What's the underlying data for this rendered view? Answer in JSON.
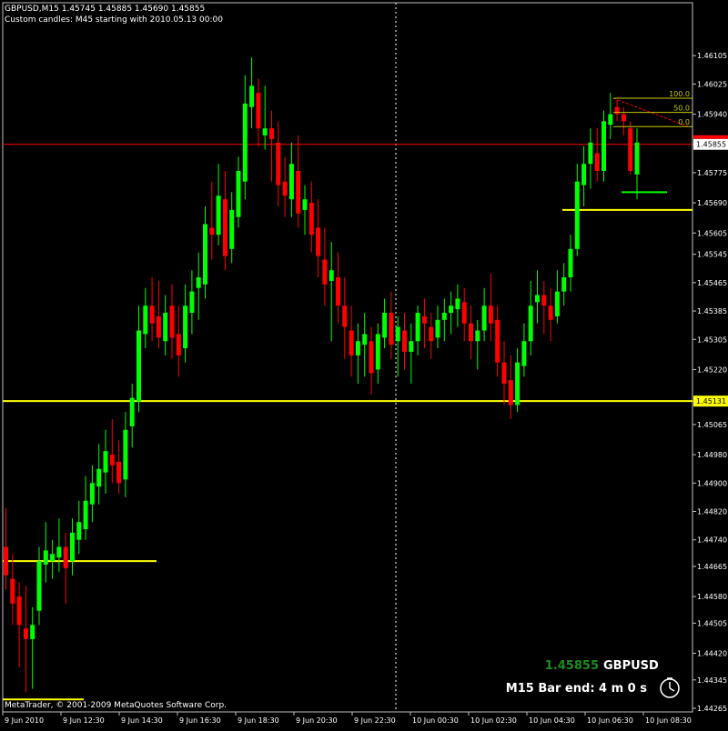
{
  "header": {
    "line1": "GBPUSD,M15  1.45745 1.45885 1.45690 1.45855",
    "line2": "Custom candles: M45 starting with 2010.05.13 00:00"
  },
  "footer": {
    "copyright": "MetaTrader, © 2001-2009 MetaQuotes Software Corp."
  },
  "info_panel": {
    "price": "1.45855",
    "symbol": "GBPUSD",
    "bar_end": "M15 Bar end: 4 m 0 s",
    "icon": "clock-icon"
  },
  "colors": {
    "background": "#000000",
    "bull": "#00ff00",
    "bear": "#ff0000",
    "level": "#ffff00",
    "bid_line": "#ff0000",
    "fib": "#c8c800",
    "price_label_green": "#1e8c1e"
  },
  "price_axis": {
    "ticks": [
      "1.46105",
      "1.46025",
      "1.45940",
      "1.45855",
      "1.45775",
      "1.45690",
      "1.45605",
      "1.45545",
      "1.45465",
      "1.45385",
      "1.45305",
      "1.45220",
      "1.45131",
      "1.45065",
      "1.44980",
      "1.44900",
      "1.44820",
      "1.44740",
      "1.44665",
      "1.44580",
      "1.44505",
      "1.44420",
      "1.44345",
      "1.44265"
    ],
    "current_price_label": "1.45855",
    "level_label": "1.45131"
  },
  "time_axis": {
    "ticks": [
      "9 Jun 2010",
      "9 Jun 12:30",
      "9 Jun 14:30",
      "9 Jun 16:30",
      "9 Jun 18:30",
      "9 Jun 20:30",
      "9 Jun 22:30",
      "10 Jun 00:30",
      "10 Jun 02:30",
      "10 Jun 04:30",
      "10 Jun 06:30",
      "10 Jun 08:30"
    ]
  },
  "fib": {
    "levels": [
      "100.0",
      "50.0",
      "0.0"
    ]
  },
  "chart_data": {
    "type": "candlestick",
    "ylim": [
      1.44265,
      1.46185
    ],
    "grid": false,
    "horizontal_levels": [
      1.45131,
      1.4567
    ],
    "candles": [
      {
        "o": 1.4472,
        "h": 1.4483,
        "l": 1.446,
        "c": 1.4464
      },
      {
        "o": 1.4463,
        "h": 1.447,
        "l": 1.445,
        "c": 1.4456
      },
      {
        "o": 1.4458,
        "h": 1.4462,
        "l": 1.4438,
        "c": 1.445
      },
      {
        "o": 1.4449,
        "h": 1.4461,
        "l": 1.4431,
        "c": 1.4446
      },
      {
        "o": 1.4446,
        "h": 1.4455,
        "l": 1.4432,
        "c": 1.445
      },
      {
        "o": 1.4454,
        "h": 1.4472,
        "l": 1.445,
        "c": 1.4468
      },
      {
        "o": 1.4467,
        "h": 1.4479,
        "l": 1.4462,
        "c": 1.4471
      },
      {
        "o": 1.4468,
        "h": 1.4474,
        "l": 1.4463,
        "c": 1.447
      },
      {
        "o": 1.4469,
        "h": 1.448,
        "l": 1.4465,
        "c": 1.4472
      },
      {
        "o": 1.4472,
        "h": 1.4476,
        "l": 1.4456,
        "c": 1.4466
      },
      {
        "o": 1.4468,
        "h": 1.448,
        "l": 1.4464,
        "c": 1.4476
      },
      {
        "o": 1.4474,
        "h": 1.4485,
        "l": 1.447,
        "c": 1.4479
      },
      {
        "o": 1.4477,
        "h": 1.4492,
        "l": 1.4474,
        "c": 1.4485
      },
      {
        "o": 1.4484,
        "h": 1.4495,
        "l": 1.4479,
        "c": 1.449
      },
      {
        "o": 1.4489,
        "h": 1.4501,
        "l": 1.4484,
        "c": 1.4494
      },
      {
        "o": 1.4493,
        "h": 1.4505,
        "l": 1.4487,
        "c": 1.4499
      },
      {
        "o": 1.4498,
        "h": 1.4508,
        "l": 1.449,
        "c": 1.4495
      },
      {
        "o": 1.4496,
        "h": 1.4502,
        "l": 1.4487,
        "c": 1.449
      },
      {
        "o": 1.4491,
        "h": 1.451,
        "l": 1.4486,
        "c": 1.4505
      },
      {
        "o": 1.4506,
        "h": 1.4518,
        "l": 1.45,
        "c": 1.4514
      },
      {
        "o": 1.4513,
        "h": 1.454,
        "l": 1.451,
        "c": 1.4533
      },
      {
        "o": 1.4532,
        "h": 1.4545,
        "l": 1.4528,
        "c": 1.454
      },
      {
        "o": 1.454,
        "h": 1.4548,
        "l": 1.453,
        "c": 1.4535
      },
      {
        "o": 1.4537,
        "h": 1.4547,
        "l": 1.4528,
        "c": 1.4531
      },
      {
        "o": 1.453,
        "h": 1.4543,
        "l": 1.4526,
        "c": 1.4538
      },
      {
        "o": 1.454,
        "h": 1.4546,
        "l": 1.4525,
        "c": 1.4531
      },
      {
        "o": 1.4532,
        "h": 1.454,
        "l": 1.452,
        "c": 1.4526
      },
      {
        "o": 1.4528,
        "h": 1.4546,
        "l": 1.4524,
        "c": 1.454
      },
      {
        "o": 1.4538,
        "h": 1.455,
        "l": 1.4532,
        "c": 1.4544
      },
      {
        "o": 1.4545,
        "h": 1.4555,
        "l": 1.4536,
        "c": 1.4548
      },
      {
        "o": 1.4546,
        "h": 1.4568,
        "l": 1.4542,
        "c": 1.4563
      },
      {
        "o": 1.4562,
        "h": 1.4575,
        "l": 1.4553,
        "c": 1.456
      },
      {
        "o": 1.456,
        "h": 1.458,
        "l": 1.4557,
        "c": 1.4571
      },
      {
        "o": 1.457,
        "h": 1.4578,
        "l": 1.455,
        "c": 1.4554
      },
      {
        "o": 1.4556,
        "h": 1.4572,
        "l": 1.4552,
        "c": 1.4567
      },
      {
        "o": 1.4565,
        "h": 1.4582,
        "l": 1.4562,
        "c": 1.4578
      },
      {
        "o": 1.4575,
        "h": 1.4605,
        "l": 1.457,
        "c": 1.4597
      },
      {
        "o": 1.4596,
        "h": 1.461,
        "l": 1.459,
        "c": 1.4602
      },
      {
        "o": 1.46,
        "h": 1.4604,
        "l": 1.4585,
        "c": 1.459
      },
      {
        "o": 1.4588,
        "h": 1.4602,
        "l": 1.4584,
        "c": 1.459
      },
      {
        "o": 1.459,
        "h": 1.4595,
        "l": 1.4575,
        "c": 1.4587
      },
      {
        "o": 1.4586,
        "h": 1.4592,
        "l": 1.4568,
        "c": 1.4574
      },
      {
        "o": 1.4575,
        "h": 1.4582,
        "l": 1.4565,
        "c": 1.4571
      },
      {
        "o": 1.457,
        "h": 1.4586,
        "l": 1.4565,
        "c": 1.458
      },
      {
        "o": 1.4578,
        "h": 1.4588,
        "l": 1.4562,
        "c": 1.4566
      },
      {
        "o": 1.4567,
        "h": 1.4574,
        "l": 1.456,
        "c": 1.457
      },
      {
        "o": 1.4569,
        "h": 1.4575,
        "l": 1.4555,
        "c": 1.456
      },
      {
        "o": 1.4562,
        "h": 1.457,
        "l": 1.4548,
        "c": 1.4554
      },
      {
        "o": 1.4553,
        "h": 1.4562,
        "l": 1.454,
        "c": 1.4546
      },
      {
        "o": 1.4547,
        "h": 1.4558,
        "l": 1.453,
        "c": 1.455
      },
      {
        "o": 1.4548,
        "h": 1.4555,
        "l": 1.4535,
        "c": 1.454
      },
      {
        "o": 1.454,
        "h": 1.4548,
        "l": 1.4525,
        "c": 1.4534
      },
      {
        "o": 1.4533,
        "h": 1.454,
        "l": 1.452,
        "c": 1.4526
      },
      {
        "o": 1.4526,
        "h": 1.4535,
        "l": 1.4518,
        "c": 1.453
      },
      {
        "o": 1.4529,
        "h": 1.4538,
        "l": 1.452,
        "c": 1.4532
      },
      {
        "o": 1.453,
        "h": 1.4534,
        "l": 1.4515,
        "c": 1.4521
      },
      {
        "o": 1.4522,
        "h": 1.4535,
        "l": 1.4518,
        "c": 1.4532
      },
      {
        "o": 1.4531,
        "h": 1.4542,
        "l": 1.4528,
        "c": 1.4538
      },
      {
        "o": 1.4538,
        "h": 1.4544,
        "l": 1.4525,
        "c": 1.4529
      },
      {
        "o": 1.453,
        "h": 1.4537,
        "l": 1.452,
        "c": 1.4534
      },
      {
        "o": 1.4533,
        "h": 1.4538,
        "l": 1.4522,
        "c": 1.4527
      },
      {
        "o": 1.4527,
        "h": 1.4535,
        "l": 1.4518,
        "c": 1.453
      },
      {
        "o": 1.453,
        "h": 1.454,
        "l": 1.4526,
        "c": 1.4538
      },
      {
        "o": 1.4537,
        "h": 1.4542,
        "l": 1.4528,
        "c": 1.4535
      },
      {
        "o": 1.4534,
        "h": 1.4538,
        "l": 1.4525,
        "c": 1.453
      },
      {
        "o": 1.4531,
        "h": 1.454,
        "l": 1.4528,
        "c": 1.4536
      },
      {
        "o": 1.4536,
        "h": 1.4542,
        "l": 1.453,
        "c": 1.4538
      },
      {
        "o": 1.4538,
        "h": 1.4544,
        "l": 1.4532,
        "c": 1.454
      },
      {
        "o": 1.4539,
        "h": 1.4546,
        "l": 1.4534,
        "c": 1.4542
      },
      {
        "o": 1.4541,
        "h": 1.4545,
        "l": 1.453,
        "c": 1.4535
      },
      {
        "o": 1.4535,
        "h": 1.454,
        "l": 1.4525,
        "c": 1.453
      },
      {
        "o": 1.453,
        "h": 1.4536,
        "l": 1.4522,
        "c": 1.4533
      },
      {
        "o": 1.4533,
        "h": 1.4545,
        "l": 1.453,
        "c": 1.454
      },
      {
        "o": 1.454,
        "h": 1.4549,
        "l": 1.453,
        "c": 1.4535
      },
      {
        "o": 1.4536,
        "h": 1.454,
        "l": 1.452,
        "c": 1.4524
      },
      {
        "o": 1.4524,
        "h": 1.453,
        "l": 1.4512,
        "c": 1.4518
      },
      {
        "o": 1.4519,
        "h": 1.4526,
        "l": 1.4508,
        "c": 1.4512
      },
      {
        "o": 1.4512,
        "h": 1.4528,
        "l": 1.451,
        "c": 1.4524
      },
      {
        "o": 1.4523,
        "h": 1.4535,
        "l": 1.452,
        "c": 1.453
      },
      {
        "o": 1.453,
        "h": 1.4547,
        "l": 1.4526,
        "c": 1.454
      },
      {
        "o": 1.4541,
        "h": 1.455,
        "l": 1.4535,
        "c": 1.4543
      },
      {
        "o": 1.4543,
        "h": 1.4547,
        "l": 1.4532,
        "c": 1.454
      },
      {
        "o": 1.454,
        "h": 1.4545,
        "l": 1.453,
        "c": 1.4536
      },
      {
        "o": 1.4537,
        "h": 1.455,
        "l": 1.4535,
        "c": 1.4544
      },
      {
        "o": 1.4544,
        "h": 1.4552,
        "l": 1.454,
        "c": 1.4548
      },
      {
        "o": 1.4548,
        "h": 1.456,
        "l": 1.4544,
        "c": 1.4556
      },
      {
        "o": 1.4556,
        "h": 1.458,
        "l": 1.4554,
        "c": 1.4575
      },
      {
        "o": 1.4574,
        "h": 1.4585,
        "l": 1.4568,
        "c": 1.458
      },
      {
        "o": 1.458,
        "h": 1.459,
        "l": 1.4573,
        "c": 1.4586
      },
      {
        "o": 1.4583,
        "h": 1.459,
        "l": 1.4575,
        "c": 1.4578
      },
      {
        "o": 1.4578,
        "h": 1.4595,
        "l": 1.4575,
        "c": 1.4592
      },
      {
        "o": 1.4591,
        "h": 1.46,
        "l": 1.4587,
        "c": 1.4594
      },
      {
        "o": 1.4596,
        "h": 1.4598,
        "l": 1.4592,
        "c": 1.4594
      },
      {
        "o": 1.4594,
        "h": 1.4596,
        "l": 1.4588,
        "c": 1.4592
      },
      {
        "o": 1.459,
        "h": 1.4592,
        "l": 1.4577,
        "c": 1.4578
      },
      {
        "o": 1.4577,
        "h": 1.459,
        "l": 1.457,
        "c": 1.4586
      }
    ]
  }
}
